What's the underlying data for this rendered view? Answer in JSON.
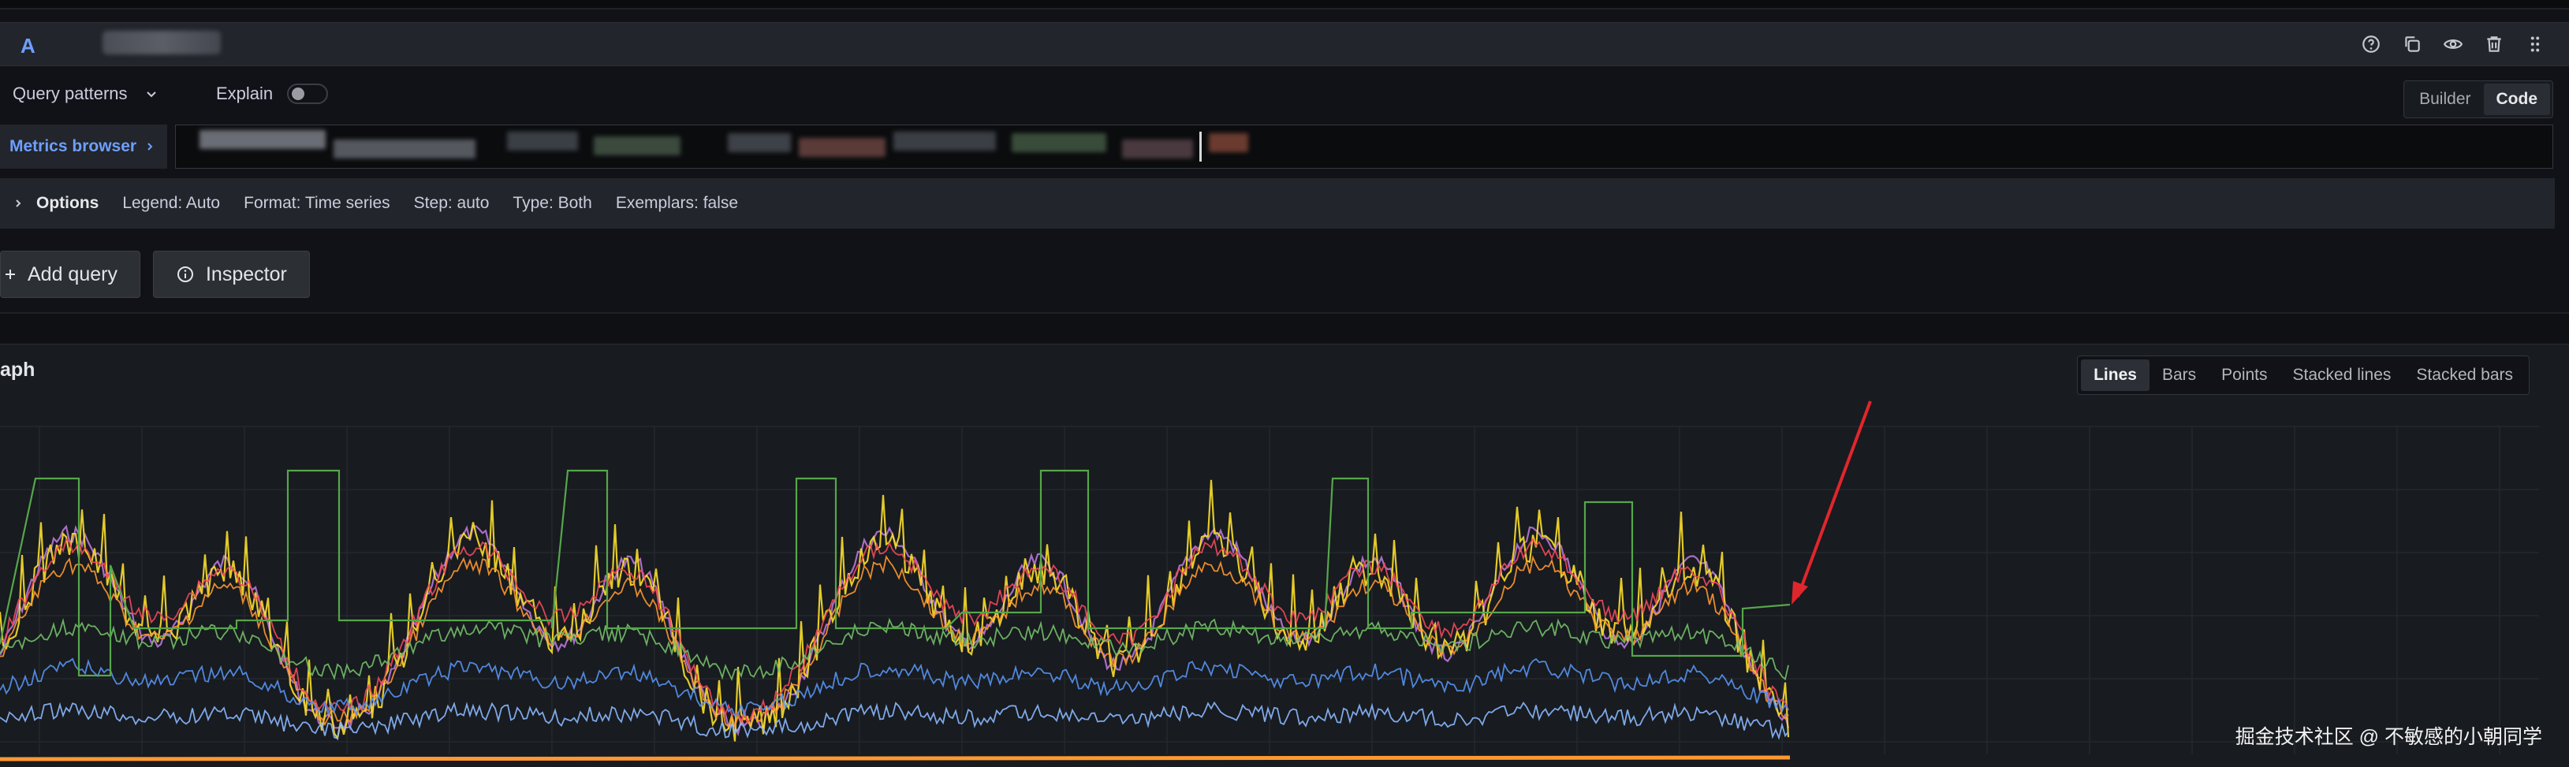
{
  "query": {
    "letter": "A",
    "icons": [
      "help-icon",
      "duplicate-icon",
      "eye-icon",
      "trash-icon",
      "drag-handle-icon"
    ]
  },
  "toolbar": {
    "patterns_label": "Query patterns",
    "explain_label": "Explain",
    "builder_label": "Builder",
    "code_label": "Code",
    "active_mode": "Code"
  },
  "metrics": {
    "browser_label": "Metrics browser"
  },
  "options": {
    "label": "Options",
    "legend": "Legend: Auto",
    "format": "Format: Time series",
    "step": "Step: auto",
    "type": "Type: Both",
    "exemplars": "Exemplars: false"
  },
  "buttons": {
    "add_query": "Add query",
    "inspector": "Inspector"
  },
  "graph": {
    "title_fragment": "aph",
    "modes": [
      "Lines",
      "Bars",
      "Points",
      "Stacked lines",
      "Stacked bars"
    ],
    "active_mode": "Lines"
  },
  "watermark": "掘金技术社区 @ 不敏感的小朝同学",
  "chart_data": {
    "type": "line",
    "grid": true,
    "legend": "none",
    "series": [
      {
        "color": "#73bf69",
        "style": "green step series"
      },
      {
        "color": "#fade2a",
        "style": "yellow"
      },
      {
        "color": "#b877d9",
        "style": "purple"
      },
      {
        "color": "#ff9830",
        "style": "orange"
      },
      {
        "color": "#f2495c",
        "style": "red"
      },
      {
        "color": "#5794f2",
        "style": "blue"
      },
      {
        "color": "#8ab8ff",
        "style": "light blue"
      }
    ],
    "annotation_arrow_color": "#e0262d"
  }
}
